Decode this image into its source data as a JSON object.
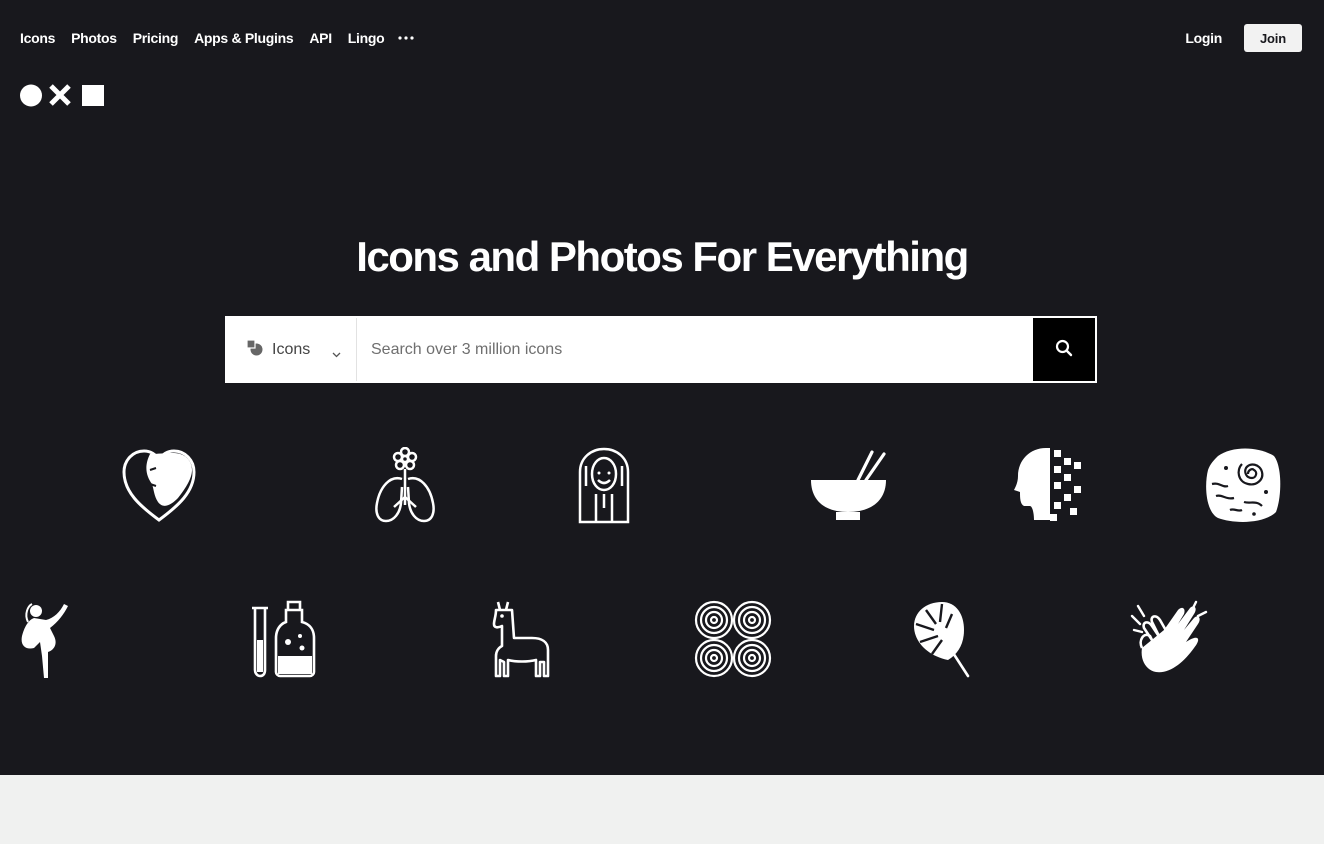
{
  "nav": {
    "links": [
      "Icons",
      "Photos",
      "Pricing",
      "Apps & Plugins",
      "API",
      "Lingo"
    ],
    "more_icon": "ellipsis-icon"
  },
  "auth": {
    "login": "Login",
    "join": "Join"
  },
  "logo_icon": "noun-project-logo",
  "hero": {
    "title": "Icons and Photos For Everything"
  },
  "search": {
    "type_label": "Icons",
    "type_icon": "icons-type-icon",
    "placeholder": "Search over 3 million icons",
    "button_icon": "magnifier-icon"
  },
  "featured_icons": [
    "heart-face-icon",
    "lungs-flower-icon",
    "woman-portrait-icon",
    "bowl-chopsticks-icon",
    "pixel-head-icon",
    "fossil-rock-icon",
    "dancer-icon",
    "test-tube-bottle-icon",
    "llama-icon",
    "spiral-pattern-icon",
    "monstera-leaf-icon",
    "clapping-hands-icon"
  ],
  "colors": {
    "hero_bg": "#18181d",
    "page_bg": "#f0f1f0",
    "accent": "#000000",
    "text_light": "#ffffff"
  }
}
